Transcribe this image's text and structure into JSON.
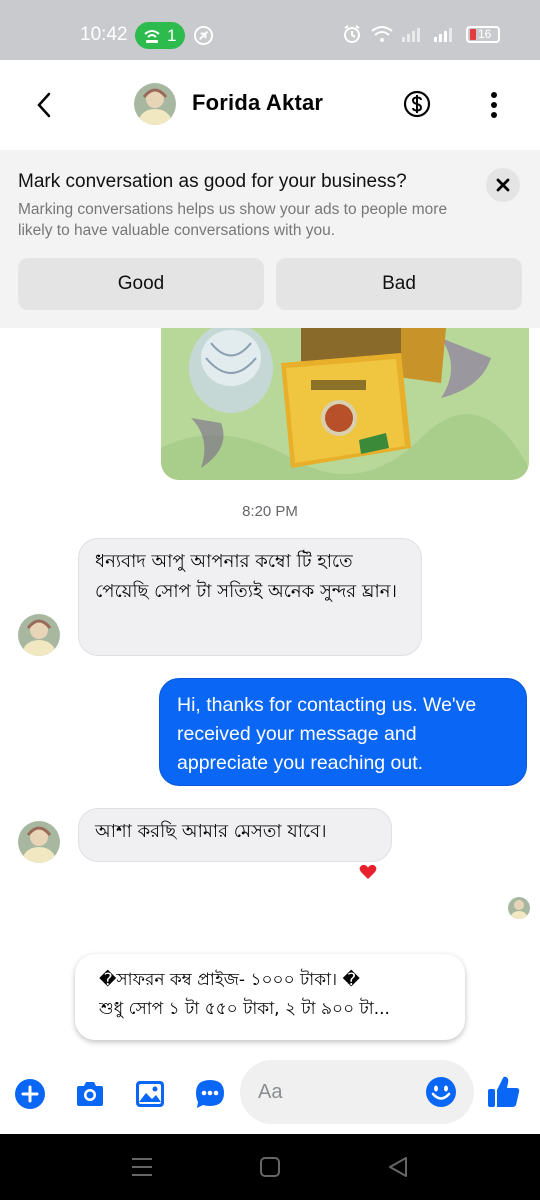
{
  "status_bar": {
    "time": "10:42",
    "hotspot_count": "1",
    "battery_level": "16",
    "battery_color": "#e23c3c",
    "icons": [
      "hotspot-icon",
      "vpn-circle-icon",
      "alarm-icon",
      "wifi-icon",
      "signal-icon",
      "battery-icon"
    ]
  },
  "header": {
    "contact_name": "Forida Aktar",
    "icons": [
      "back-arrow-icon",
      "avatar",
      "dollar-icon",
      "more-vertical-icon"
    ]
  },
  "banner": {
    "title": "Mark conversation as good for your business?",
    "description": "Marking conversations helps us show your ads to people more likely to have valuable conversations with you.",
    "good_label": "Good",
    "bad_label": "Bad"
  },
  "conversation": {
    "time_divider": "8:20 PM",
    "messages": [
      {
        "direction": "incoming",
        "text": "ধন্যবাদ আপু আপনার কম্বো টি হাতে পেয়েছি সোপ টা সত্যিই অনেক সুন্দর ঘ্রান।"
      },
      {
        "direction": "outgoing",
        "text": "Hi, thanks for contacting us. We've received your message and appreciate you reaching out."
      },
      {
        "direction": "incoming",
        "text": "আশা করছি আমার মেসতা যাবে।",
        "reaction": "heart"
      }
    ],
    "suggestion": {
      "line1": "�সাফরন কম্ব প্রাইজ- ১০০০ টাকা। �",
      "line2": "শুধু সোপ ১ টা ৫৫০ টাকা, ২ টা ৯০০ টা..."
    }
  },
  "composer": {
    "placeholder": "Aa",
    "icons": [
      "add-icon",
      "camera-icon",
      "gallery-icon",
      "chat-more-icon",
      "emoji-icon",
      "thumbs-up-icon"
    ]
  },
  "colors": {
    "accent": "#0a66f4",
    "incoming_bubble": "#f0f0f3",
    "banner_bg": "#f3f3f3",
    "status_green": "#2dbb4d"
  }
}
